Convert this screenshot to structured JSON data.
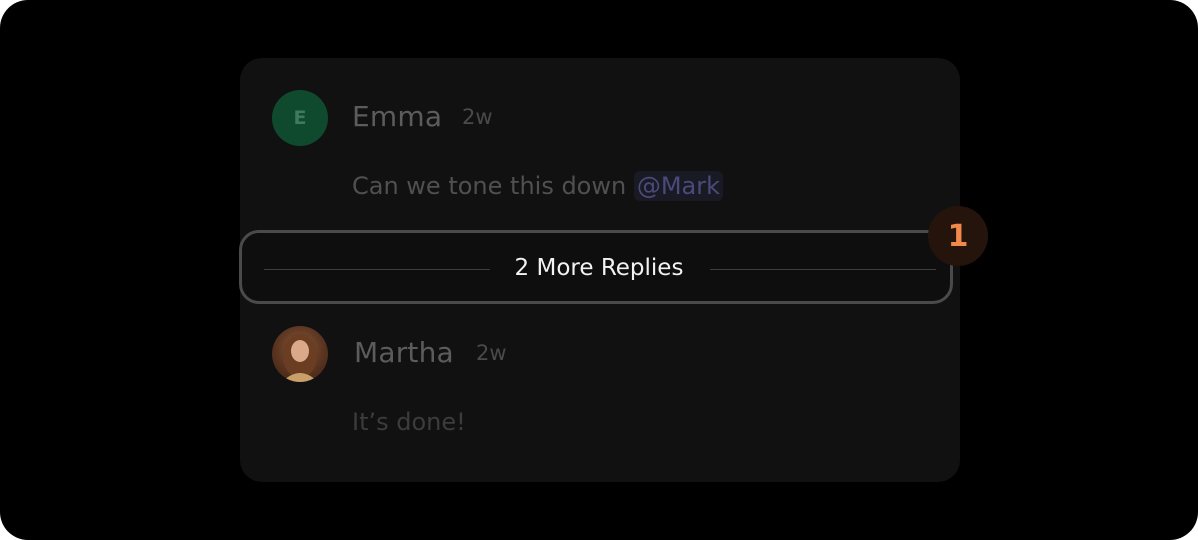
{
  "comments": [
    {
      "author": "Emma",
      "avatar_initial": "E",
      "time": "2w",
      "message": "Can we tone this down ",
      "mention": "@Mark"
    },
    {
      "author": "Martha",
      "time": "2w",
      "message": "It’s done!"
    }
  ],
  "replies_button": {
    "label": "2 More Replies"
  },
  "annotation_badge": {
    "number": "1"
  },
  "colors": {
    "background": "#000000",
    "card": "#111111",
    "emma_avatar": "#0f4a2e",
    "mention": "#4b4a7a",
    "badge_text": "#f0894a"
  }
}
